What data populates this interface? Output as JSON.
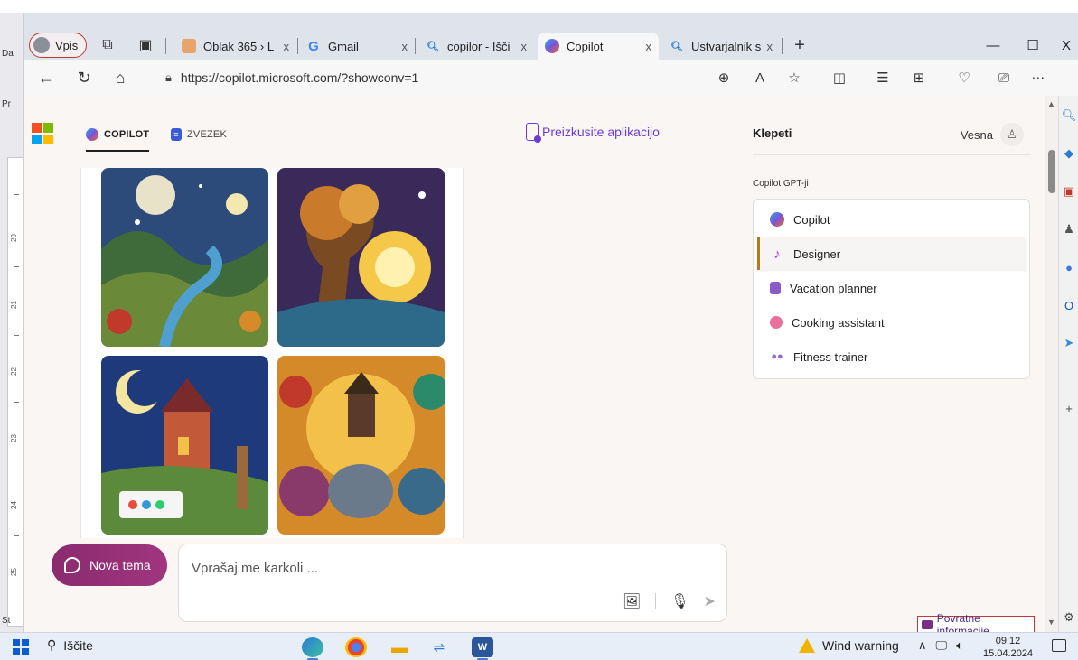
{
  "word": {
    "left_labels": [
      "Da",
      "Pr",
      "St"
    ],
    "ruler_ticks": [
      "20",
      "21",
      "22",
      "23",
      "24",
      "25"
    ]
  },
  "browser": {
    "profile_label": "Vpis",
    "tabs": [
      {
        "label": "Oblak 365 › L",
        "icon_color": "#e9a46b"
      },
      {
        "label": "Gmail",
        "icon_color": "#4285f4"
      },
      {
        "label": "copilor - Išči",
        "icon_color": "#2a7ad6"
      },
      {
        "label": "Copilot",
        "icon_color": "#7a55d6"
      },
      {
        "label": "Ustvarjalnik s",
        "icon_color": "#2a7ad6"
      }
    ],
    "tab_close": "x",
    "new_tab": "+",
    "minimize": "—",
    "maximize": "☐",
    "close": "X",
    "url": "https://copilot.microsoft.com/?showconv=1"
  },
  "page": {
    "tabs": [
      {
        "label": "COPILOT"
      },
      {
        "label": "ZVEZEK"
      }
    ],
    "try_app": "Preizkusite aplikacijo",
    "new_topic": "Nova tema",
    "ask_placeholder": "Vprašaj me karkoli ...",
    "chats_title": "Klepeti",
    "user_name": "Vesna",
    "gpts_label": "Copilot GPT-ji",
    "gpts": [
      {
        "label": "Copilot"
      },
      {
        "label": "Designer"
      },
      {
        "label": "Vacation planner"
      },
      {
        "label": "Cooking assistant"
      },
      {
        "label": "Fitness trainer"
      }
    ],
    "feedback": "Povratne informacije"
  },
  "taskbar": {
    "search": "Iščite",
    "weather": "Wind warning",
    "time": "09:12",
    "date": "15.04.2024"
  },
  "colors": {
    "accent_purple": "#6b3bd6",
    "new_topic_bg": "#8a2b6e",
    "selected_border": "#b37a1e"
  }
}
